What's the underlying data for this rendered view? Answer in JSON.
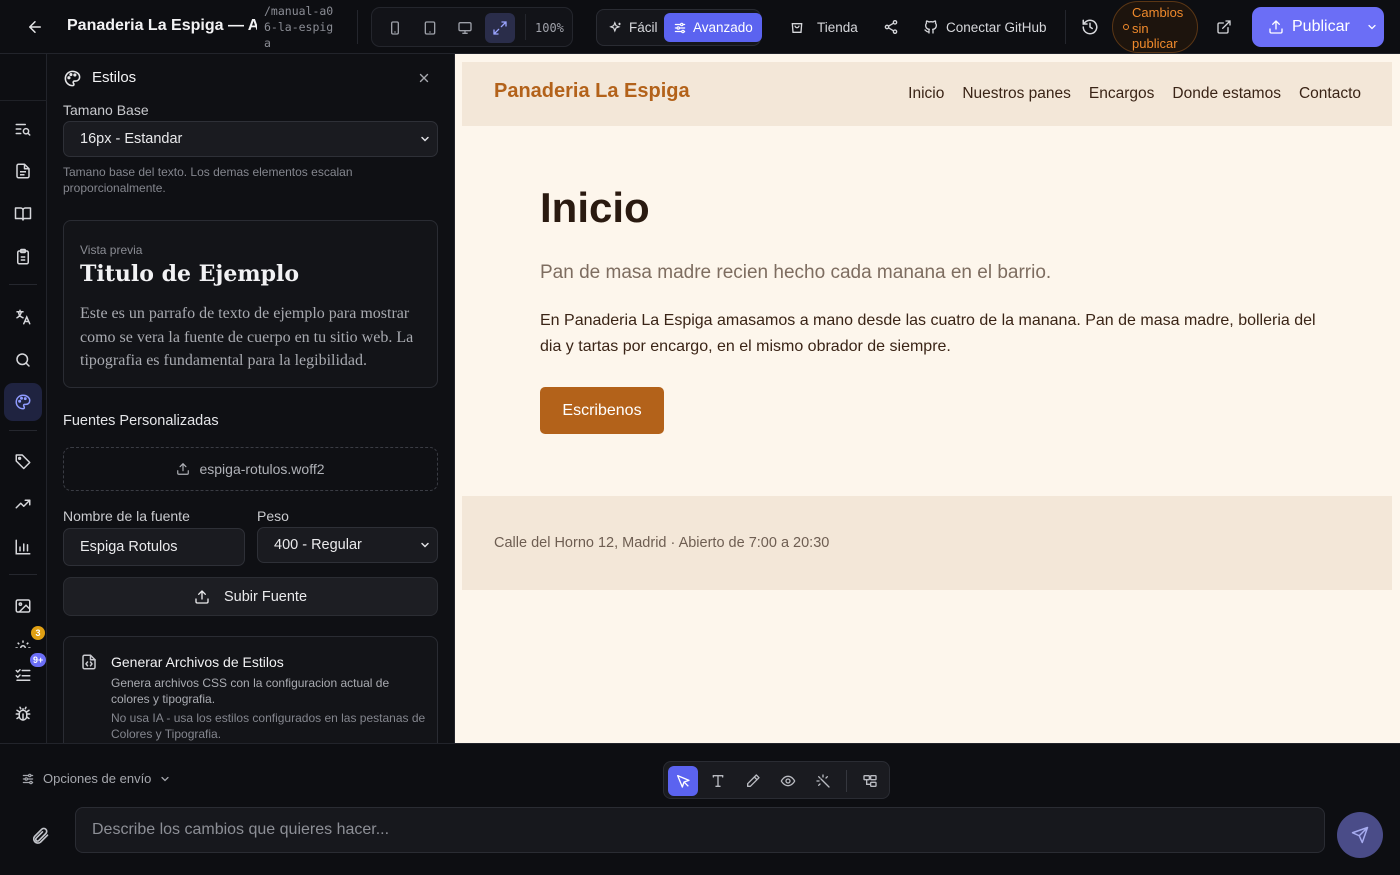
{
  "topbar": {
    "project_title": "Panaderia La Espiga — A...",
    "project_slug": "/manual-a06-la-espiga",
    "zoom": "100%",
    "modes": {
      "easy": "Fácil",
      "advanced": "Avanzado",
      "active": "advanced"
    },
    "store_label": "Tienda",
    "github_label": "Conectar GitHub",
    "unpublished_label": "Cambios sin publicar",
    "publish_label": "Publicar",
    "unpublished_color": "#f08a2c",
    "accent_color": "#6b6ef6"
  },
  "rail": {
    "active_item": "styles",
    "items": [
      "search-list",
      "file",
      "book",
      "clipboard",
      "translate",
      "search",
      "palette",
      "tags",
      "trend",
      "bar-chart",
      "image",
      "settings",
      "checklist",
      "bug"
    ],
    "badges": {
      "settings": "3",
      "checklist": "9+"
    }
  },
  "panel": {
    "title": "Estilos",
    "base_size_label": "Tamano Base",
    "base_size_value": "16px - Estandar",
    "base_size_help": "Tamano base del texto. Los demas elementos escalan proporcionalmente.",
    "preview_kicker": "Vista previa",
    "preview_title": "Titulo de Ejemplo",
    "preview_body": "Este es un parrafo de texto de ejemplo para mostrar como se vera la fuente de cuerpo en tu sitio web. La tipografia es fundamental para la legibilidad.",
    "custom_fonts_title": "Fuentes Personalizadas",
    "uploaded_file": "espiga-rotulos.woff2",
    "font_name_label": "Nombre de la fuente",
    "font_name_value": "Espiga Rotulos",
    "weight_label": "Peso",
    "weight_value": "400 - Regular",
    "upload_font_label": "Subir Fuente",
    "generate_title": "Generar Archivos de Estilos",
    "generate_desc": "Genera archivos CSS con la configuracion actual de colores y tipografia.",
    "generate_note": "No usa IA - usa los estilos configurados en las pestanas de Colores y Tipografia."
  },
  "site": {
    "logo": "Panaderia La Espiga",
    "nav": [
      "Inicio",
      "Nuestros panes",
      "Encargos",
      "Donde estamos",
      "Contacto"
    ],
    "hero_title": "Inicio",
    "hero_subtitle": "Pan de masa madre recien hecho cada manana en el barrio.",
    "hero_body": "En Panaderia La Espiga amasamos a mano desde las cuatro de la manana. Pan de masa madre, bolleria del dia y tartas por encargo, en el mismo obrador de siempre.",
    "cta": "Escribenos",
    "footer": "Calle del Horno 12, Madrid · Abierto de 7:00 a 20:30",
    "brand_color": "#b3621a",
    "bg_color": "#fdf6ec"
  },
  "chat": {
    "send_options_label": "Opciones de envío",
    "placeholder": "Describe los cambios que quieres hacer...",
    "active_tool": "select"
  }
}
